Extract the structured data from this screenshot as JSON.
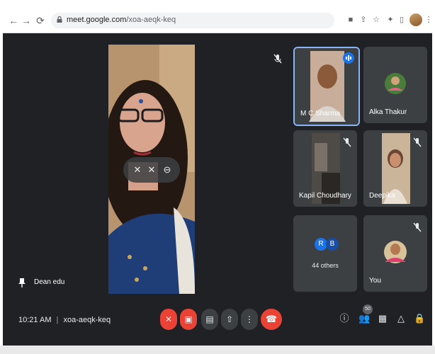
{
  "browser": {
    "url_host": "meet.google.com",
    "url_path": "/xoa-aeqk-keq"
  },
  "main_speaker": {
    "name": "Dean edu"
  },
  "participants": [
    {
      "name": "M C Sharma",
      "muted": false,
      "speaking": true
    },
    {
      "name": "Alka Thakur",
      "muted": false
    },
    {
      "name": "Kapil Choudhary",
      "muted": true
    },
    {
      "name": "Deepika",
      "muted": true
    },
    {
      "name": "44 others",
      "initials": [
        "R",
        "B"
      ]
    },
    {
      "name": "You",
      "muted": true
    }
  ],
  "bottom": {
    "time": "10:21 AM",
    "separator": "|",
    "meeting_code": "xoa-aeqk-keq",
    "people_count": "50"
  },
  "colors": {
    "danger": "#ea4335",
    "speaking": "#1a73e8",
    "surface": "#202124",
    "tile": "#3c4043"
  }
}
